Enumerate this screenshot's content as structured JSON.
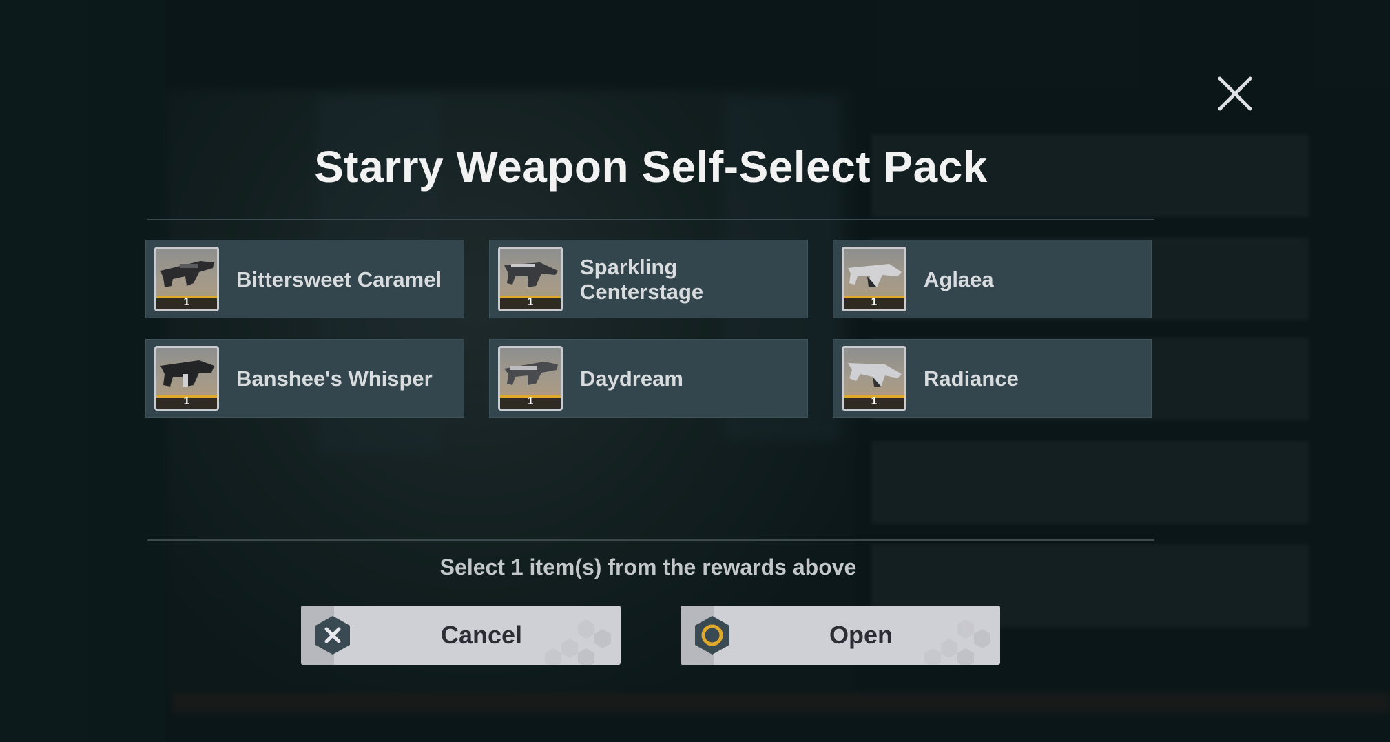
{
  "dialog": {
    "title": "Starry Weapon Self-Select Pack",
    "hint": "Select 1 item(s) from the rewards above",
    "cancel_label": "Cancel",
    "open_label": "Open"
  },
  "rewards": [
    {
      "name": "Bittersweet Caramel",
      "qty": "1"
    },
    {
      "name": "Sparkling Centerstage",
      "qty": "1"
    },
    {
      "name": "Aglaea",
      "qty": "1"
    },
    {
      "name": "Banshee's Whisper",
      "qty": "1"
    },
    {
      "name": "Daydream",
      "qty": "1"
    },
    {
      "name": "Radiance",
      "qty": "1"
    }
  ],
  "icons": {
    "close": "close-icon",
    "cancel": "cross-hex-icon",
    "open": "circle-hex-icon",
    "weapon": "rifle-icon"
  },
  "colors": {
    "card_bg": "#33454d",
    "rarity_strip": "#e0a92b",
    "button_bg": "#cfd0d6",
    "open_accent": "#e0a92b"
  }
}
